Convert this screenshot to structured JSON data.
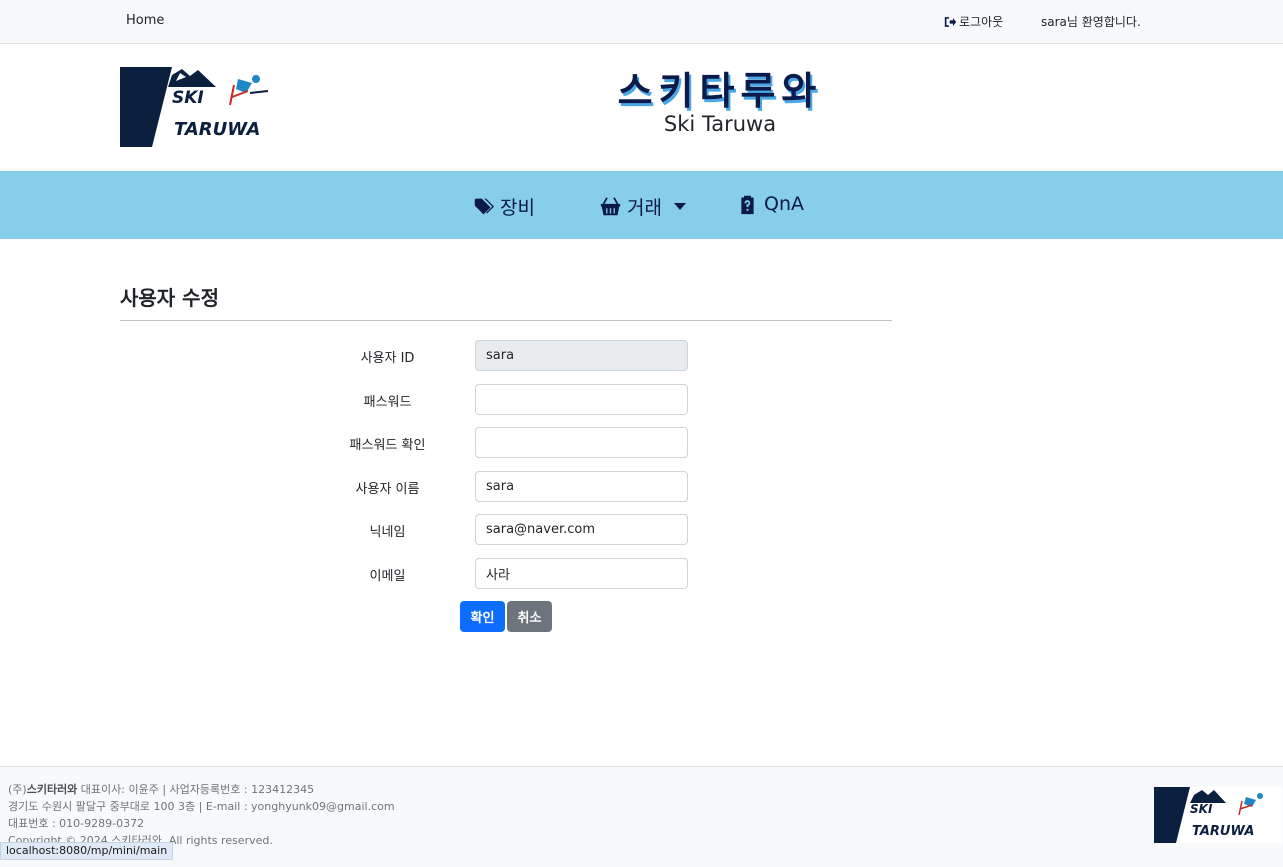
{
  "topbar": {
    "home": "Home",
    "logout": "로그아웃",
    "welcome": "sara님 환영합니다."
  },
  "header": {
    "title": "스키타루와",
    "subtitle": "Ski Taruwa",
    "logo_text_top": "SKI",
    "logo_text_bottom": "TARUWA"
  },
  "nav": {
    "items": [
      {
        "label": "장비",
        "icon": "tags-icon"
      },
      {
        "label": "거래",
        "icon": "basket-icon"
      },
      {
        "label": "QnA",
        "icon": "clipboard-question-icon"
      }
    ]
  },
  "form": {
    "title": "사용자 수정",
    "fields": [
      {
        "label": "사용자 ID",
        "value": ""
      },
      {
        "label": "패스워드",
        "value": ""
      },
      {
        "label": "패스워드 확인",
        "value": ""
      },
      {
        "label": "사용자 이름",
        "value": "sara"
      },
      {
        "label": "닉네임",
        "value": "sara@naver.com"
      },
      {
        "label": "이메일",
        "value": "사라"
      }
    ],
    "userid_value": "sara",
    "ok": "확인",
    "cancel": "취소"
  },
  "footer": {
    "line1_prefix": "(주)",
    "line1_company": "스키타러와",
    "line1_rest": " 대표이사: 이윤주 | 사업자등록번호 : 123412345",
    "line2": "경기도 수원시 팔달구 중부대로 100 3층 | E-mail : yonghyunk09@gmail.com",
    "line3": "대표번호 : 010-9289-0372",
    "line4": "Copyright © 2024 스키타러와. All rights reserved."
  },
  "statusbar": "localhost:8080/mp/mini/main",
  "colors": {
    "nav_bg": "#87ceeb",
    "primary": "#0d6efd",
    "secondary": "#6c757d",
    "title_navy": "#0b1a4a"
  }
}
